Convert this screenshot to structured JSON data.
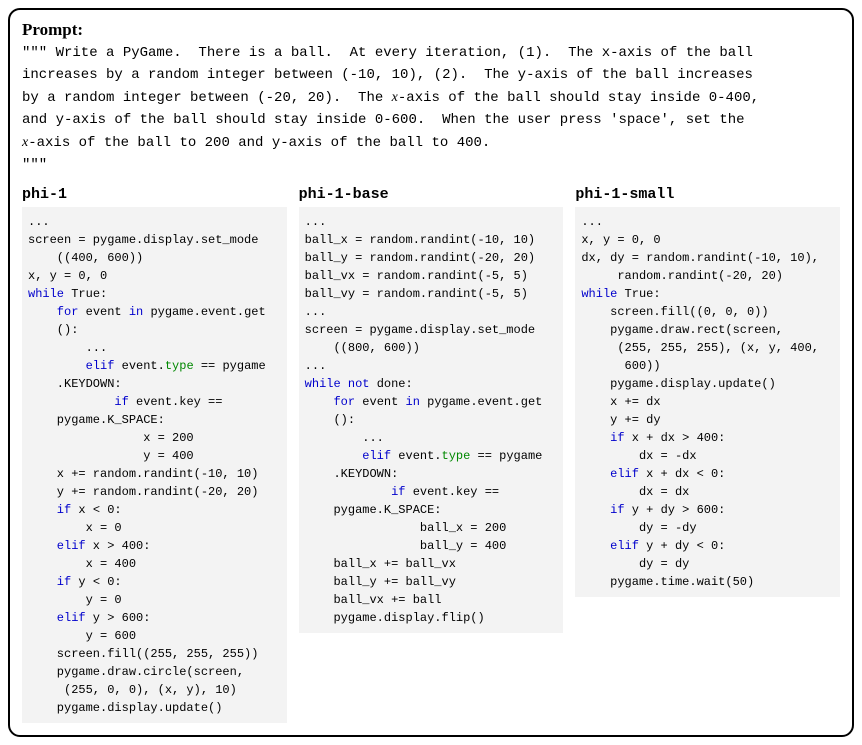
{
  "prompt": {
    "title": "Prompt:",
    "line_open": "\"\"\" Write a PyGame.  There is a ball.  At every iteration, (1).  The x-axis of the ball",
    "line2a": "increases by a random integer between (-10, 10), (2).  The y-axis of the ball increases",
    "line3_pre": "by a random integer between (-20, 20).  The ",
    "line3_x": "x",
    "line3_post": "-axis of the ball should stay inside 0-400,",
    "line4": "and y-axis of the ball should stay inside 0-600.  When the user press 'space', set the",
    "line5_x": "x",
    "line5_post": "-axis of the ball to 200 and y-axis of the ball to 400.",
    "line_close": "\"\"\""
  },
  "col1": {
    "header": "phi-1"
  },
  "col2": {
    "header": "phi-1-base"
  },
  "col3": {
    "header": "phi-1-small"
  },
  "code1": {
    "l01": "...",
    "l02a": "screen = pygame.display.set_mode",
    "l02b": "    ((400, 600))",
    "l03": "x, y = 0, 0",
    "l04a": "while",
    "l04b": " True:",
    "l05a": "    for",
    "l05b": " event ",
    "l05c": "in",
    "l05d": " pygame.event.get",
    "l05e": "    ():",
    "l06a": "        ...",
    "l06b": "        elif",
    "l06c": " event.",
    "l06d": "type",
    "l06e": " == pygame",
    "l06f": "    .KEYDOWN:",
    "l07a": "            if",
    "l07b": " event.key ==",
    "l07c": "    pygame.K_SPACE:",
    "l08": "                x = 200",
    "l09": "                y = 400",
    "l10": "    x += random.randint(-10, 10)",
    "l11": "    y += random.randint(-20, 20)",
    "l12a": "    if",
    "l12b": " x < 0:",
    "l13": "        x = 0",
    "l14a": "    elif",
    "l14b": " x > 400:",
    "l15": "        x = 400",
    "l16a": "    if",
    "l16b": " y < 0:",
    "l17": "        y = 0",
    "l18a": "    elif",
    "l18b": " y > 600:",
    "l19": "        y = 600",
    "l20": "    screen.fill((255, 255, 255))",
    "l21": "    pygame.draw.circle(screen,",
    "l22": "     (255, 0, 0), (x, y), 10)",
    "l23": "    pygame.display.update()"
  },
  "code2": {
    "l01": "...",
    "l02": "ball_x = random.randint(-10, 10)",
    "l03": "ball_y = random.randint(-20, 20)",
    "l04": "ball_vx = random.randint(-5, 5)",
    "l05": "ball_vy = random.randint(-5, 5)",
    "l06": "...",
    "l07a": "screen = pygame.display.set_mode",
    "l07b": "    ((800, 600))",
    "l08": "...",
    "l09a": "while",
    "l09b": " not",
    "l09c": " done:",
    "l10a": "    for",
    "l10b": " event ",
    "l10c": "in",
    "l10d": " pygame.event.get",
    "l10e": "    ():",
    "l11a": "        ...",
    "l11b": "        elif",
    "l11c": " event.",
    "l11d": "type",
    "l11e": " == pygame",
    "l11f": "    .KEYDOWN:",
    "l12a": "            if",
    "l12b": " event.key ==",
    "l12c": "    pygame.K_SPACE:",
    "l13": "                ball_x = 200",
    "l14": "                ball_y = 400",
    "l15": "    ball_x += ball_vx",
    "l16": "    ball_y += ball_vy",
    "l17": "    ball_vx += ball",
    "l18": "    pygame.display.flip()"
  },
  "code3": {
    "l01": "...",
    "l02": "x, y = 0, 0",
    "l03a": "dx, dy = random.randint(-10, 10),",
    "l03b": "     random.randint(-20, 20)",
    "l04a": "while",
    "l04b": " True:",
    "l05": "    screen.fill((0, 0, 0))",
    "l06": "    pygame.draw.rect(screen,",
    "l07": "     (255, 255, 255), (x, y, 400,",
    "l08": "      600))",
    "l09": "    pygame.display.update()",
    "l10": "    x += dx",
    "l11": "    y += dy",
    "l12a": "    if",
    "l12b": " x + dx > 400:",
    "l13": "        dx = -dx",
    "l14a": "    elif",
    "l14b": " x + dx < 0:",
    "l15": "        dx = dx",
    "l16a": "    if",
    "l16b": " y + dy > 600:",
    "l17": "        dy = -dy",
    "l18a": "    elif",
    "l18b": " y + dy < 0:",
    "l19": "        dy = dy",
    "l20": "    pygame.time.wait(50)"
  }
}
